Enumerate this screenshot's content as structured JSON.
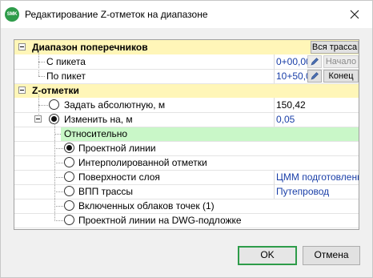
{
  "window": {
    "title": "Редактирование Z-отметок на диапазоне",
    "app_icon_text": "SMK",
    "accent_color": "#2e9c4a"
  },
  "grid": {
    "range_section": {
      "title": "Диапазон поперечников",
      "all_route_button": "Вся трасса",
      "rows": [
        {
          "label": "С пикета",
          "value": "0+00,00",
          "button": "Начало",
          "button_disabled": true
        },
        {
          "label": "По пикет",
          "value": "10+50,00",
          "button": "Конец",
          "button_disabled": false
        }
      ]
    },
    "z_section": {
      "title": "Z-отметки",
      "absolute": {
        "label": "Задать абсолютную, м",
        "value": "150,42",
        "selected": false
      },
      "change": {
        "label": "Изменить на, м",
        "value": "0,05",
        "selected": true
      },
      "relative_group": {
        "label": "Относительно"
      },
      "options": [
        {
          "label": "Проектной линии",
          "value": "",
          "selected": true
        },
        {
          "label": "Интерполированной отметки",
          "value": "",
          "selected": false
        },
        {
          "label": "Поверхности слоя",
          "value": "ЦММ подготовленная",
          "selected": false
        },
        {
          "label": "ВПП трассы",
          "value": "Путепровод",
          "selected": false
        },
        {
          "label": "Включенных облаков точек (1)",
          "value": "",
          "selected": false
        },
        {
          "label": "Проектной линии на DWG-подложке",
          "value": "",
          "selected": false
        }
      ]
    }
  },
  "footer": {
    "ok": "OK",
    "cancel": "Отмена"
  }
}
